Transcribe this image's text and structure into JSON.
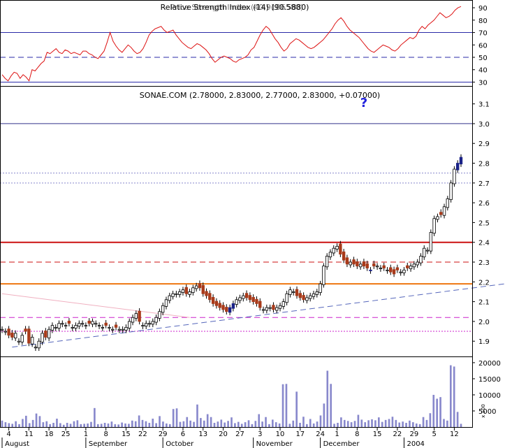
{
  "chart_data": [
    {
      "type": "line",
      "panel": "indicator",
      "title": "Relative Strength Index (14) (90.5880)",
      "overlay_text": "Price Strength Index (40,9106580)",
      "yticks": [
        30,
        40,
        50,
        60,
        70,
        80,
        90
      ],
      "ylim": [
        28,
        94
      ],
      "reference_lines": [
        {
          "value": 70,
          "style": "solid",
          "color": "#2a2aa8"
        },
        {
          "value": 50,
          "style": "dashed",
          "color": "#2a2aa8"
        },
        {
          "value": 30,
          "style": "solid",
          "color": "#2a2aa8"
        }
      ],
      "series": [
        {
          "color": "#dd1111",
          "values": [
            36,
            33,
            31,
            35,
            38,
            37,
            33,
            36,
            34,
            31,
            40,
            39,
            42,
            45,
            47,
            54,
            53,
            55,
            57,
            54,
            53,
            56,
            55,
            53,
            54,
            53,
            52,
            55,
            55,
            53,
            52,
            50,
            49,
            52,
            55,
            62,
            70,
            63,
            59,
            56,
            54,
            57,
            60,
            58,
            55,
            53,
            54,
            57,
            62,
            68,
            71,
            73,
            74,
            75,
            72,
            70,
            71,
            72,
            68,
            65,
            62,
            60,
            58,
            57,
            59,
            61,
            60,
            58,
            56,
            53,
            49,
            46,
            48,
            50,
            51,
            50,
            49,
            47,
            46,
            48,
            49,
            50,
            52,
            56,
            58,
            63,
            68,
            72,
            75,
            73,
            69,
            65,
            62,
            58,
            55,
            57,
            61,
            63,
            65,
            64,
            62,
            60,
            58,
            57,
            58,
            60,
            62,
            64,
            67,
            70,
            73,
            77,
            80,
            82,
            79,
            75,
            72,
            70,
            68,
            66,
            63,
            60,
            57,
            55,
            54,
            56,
            58,
            60,
            59,
            58,
            56,
            55,
            57,
            60,
            62,
            64,
            66,
            65,
            67,
            72,
            75,
            73,
            76,
            78,
            80,
            83,
            86,
            84,
            82,
            83,
            85,
            88,
            90,
            91
          ]
        }
      ]
    },
    {
      "type": "candlestick",
      "panel": "price",
      "title": "SONAE.COM (2.78000, 2.83000, 2.77000, 2.83000, +0.07000)",
      "annotation": "?",
      "yticks": [
        1.9,
        2.0,
        2.1,
        2.2,
        2.3,
        2.4,
        2.5,
        2.6,
        2.7,
        2.8,
        2.9,
        3.0,
        3.1
      ],
      "ylim": [
        1.83,
        3.18
      ],
      "horizontal_lines": [
        {
          "value": 3.0,
          "color": "#33338a",
          "style": "solid"
        },
        {
          "value": 2.75,
          "color": "#8888cc",
          "style": "dotted"
        },
        {
          "value": 2.7,
          "color": "#8888cc",
          "style": "dotted"
        },
        {
          "value": 2.4,
          "color": "#cc1111",
          "style": "solid"
        },
        {
          "value": 2.3,
          "color": "#cc1111",
          "style": "dashed"
        },
        {
          "value": 2.19,
          "color": "#ee7711",
          "style": "solid"
        },
        {
          "value": 2.02,
          "color": "#cc22cc",
          "style": "dashed"
        },
        {
          "value": 1.95,
          "color": "#cc22cc",
          "style": "dotted"
        }
      ],
      "trendlines": [
        {
          "from": {
            "index": 3,
            "value": 1.87
          },
          "to": {
            "index": 150,
            "value": 2.19
          },
          "color": "#5566bb",
          "style": "dashed"
        },
        {
          "from": {
            "index": 0,
            "value": 2.14
          },
          "to": {
            "index": 56,
            "value": 2.02
          },
          "color": "#f0b0c0",
          "style": "solid"
        }
      ],
      "up_color": "#ffffff",
      "down_color": "#a83a1a",
      "highlight_color": "#1a2288",
      "closes": [
        1.96,
        1.95,
        1.93,
        1.92,
        1.94,
        1.9,
        1.93,
        1.95,
        1.89,
        1.92,
        1.87,
        1.9,
        1.94,
        1.92,
        1.96,
        1.98,
        1.97,
        1.99,
        1.99,
        1.98,
        1.99,
        1.97,
        1.98,
        1.99,
        1.99,
        1.98,
        1.99,
        2.0,
        1.99,
        1.98,
        1.97,
        1.98,
        1.97,
        1.96,
        1.97,
        1.96,
        1.96,
        1.97,
        2.0,
        2.02,
        2.04,
        2.0,
        1.98,
        1.99,
        1.99,
        2.0,
        2.02,
        2.05,
        2.08,
        2.11,
        2.13,
        2.14,
        2.14,
        2.15,
        2.16,
        2.14,
        2.15,
        2.17,
        2.18,
        2.17,
        2.14,
        2.13,
        2.11,
        2.09,
        2.08,
        2.07,
        2.06,
        2.05,
        2.07,
        2.09,
        2.11,
        2.12,
        2.13,
        2.12,
        2.11,
        2.1,
        2.09,
        2.07,
        2.06,
        2.07,
        2.07,
        2.06,
        2.07,
        2.08,
        2.1,
        2.14,
        2.16,
        2.15,
        2.13,
        2.12,
        2.11,
        2.12,
        2.13,
        2.14,
        2.15,
        2.19,
        2.28,
        2.33,
        2.35,
        2.37,
        2.38,
        2.34,
        2.31,
        2.29,
        2.3,
        2.29,
        2.28,
        2.29,
        2.28,
        2.27,
        2.26,
        2.28,
        2.28,
        2.27,
        2.27,
        2.26,
        2.25,
        2.24,
        2.26,
        2.25,
        2.26,
        2.27,
        2.28,
        2.29,
        2.3,
        2.33,
        2.37,
        2.36,
        2.45,
        2.52,
        2.53,
        2.54,
        2.58,
        2.62,
        2.7,
        2.77,
        2.8,
        2.83
      ],
      "down_days": [
        2,
        3,
        7,
        8,
        13,
        20,
        26,
        31,
        34,
        41,
        55,
        59,
        60,
        61,
        62,
        63,
        64,
        65,
        66,
        67,
        73,
        74,
        75,
        76,
        77,
        81,
        88,
        89,
        90,
        101,
        102,
        103,
        105,
        106,
        108,
        109,
        111,
        114,
        116,
        117,
        118,
        121,
        131
      ],
      "highlight_days": [
        68,
        69,
        110,
        136,
        137
      ]
    },
    {
      "type": "bar",
      "panel": "volume",
      "yticks": [
        5000,
        10000,
        15000,
        20000
      ],
      "ylim": [
        0,
        21500
      ],
      "scale_label": "x 100",
      "bar_color": "#8888cc",
      "values": [
        2000,
        1500,
        1200,
        1000,
        1800,
        900,
        2500,
        3500,
        1200,
        2200,
        4200,
        3400,
        1500,
        1800,
        900,
        1300,
        2600,
        1200,
        700,
        1300,
        1000,
        1800,
        2100,
        900,
        1000,
        1100,
        1600,
        5900,
        900,
        1000,
        1300,
        1100,
        1700,
        900,
        800,
        1400,
        1100,
        1000,
        2000,
        1800,
        3600,
        2200,
        1800,
        1300,
        2600,
        1200,
        3400,
        1700,
        1100,
        900,
        5600,
        5800,
        1600,
        1800,
        3100,
        2000,
        1600,
        7000,
        2800,
        2000,
        4000,
        3100,
        1300,
        1700,
        2300,
        1400,
        1900,
        3000,
        1200,
        1600,
        1000,
        1500,
        2100,
        900,
        1900,
        4000,
        1700,
        3100,
        900,
        2300,
        1500,
        1100,
        13300,
        13400,
        1000,
        2000,
        11000,
        1300,
        3200,
        900,
        2500,
        1100,
        1700,
        3600,
        7300,
        17500,
        13400,
        1000,
        1300,
        3000,
        2200,
        1900,
        1500,
        1900,
        3800,
        2300,
        1500,
        2100,
        2400,
        2100,
        3000,
        1600,
        2200,
        2500,
        3200,
        2200,
        1400,
        1700,
        1300,
        2000,
        1500,
        1100,
        900,
        3100,
        2200,
        4300,
        10000,
        8800,
        9300,
        2500,
        2000,
        19200,
        18800,
        4700,
        1000
      ],
      "x_axis": {
        "day_labels": [
          "4",
          "11",
          "18",
          "25",
          "1",
          "8",
          "15",
          "22",
          "29",
          "6",
          "13",
          "20",
          "27",
          "3",
          "10",
          "17",
          "24",
          "1",
          "8",
          "15",
          "22",
          "29",
          "5",
          "12"
        ],
        "month_labels": [
          "August",
          "September",
          "October",
          "November",
          "December",
          "2004"
        ]
      }
    }
  ]
}
